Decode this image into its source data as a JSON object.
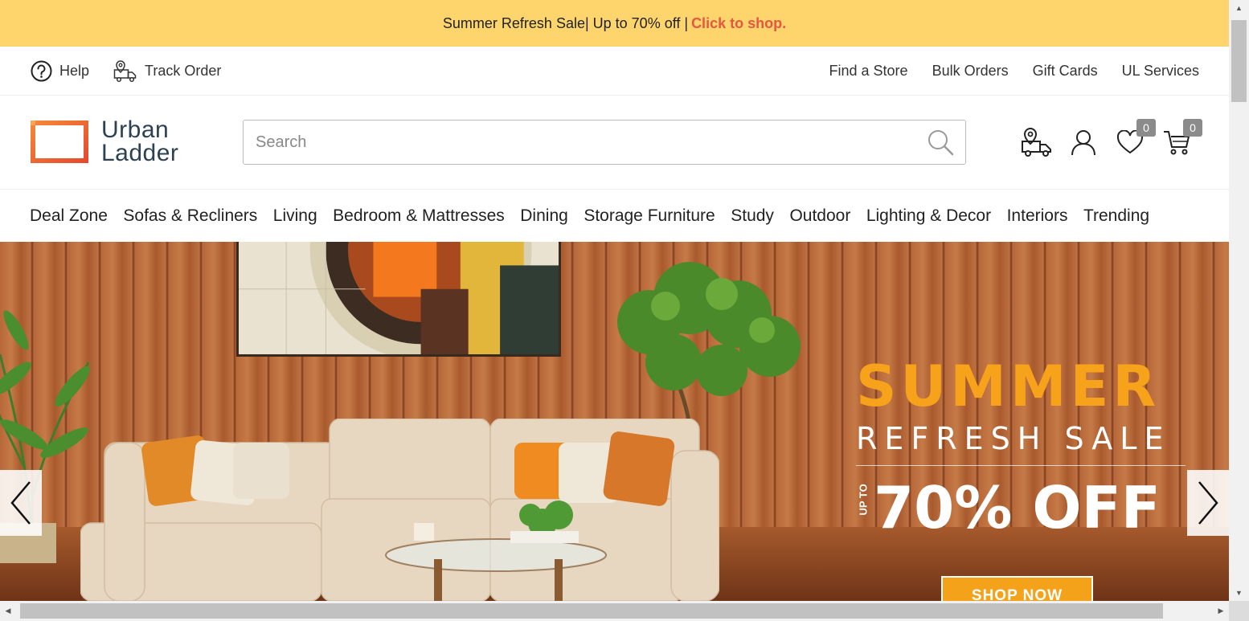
{
  "announcement": {
    "text": "Summer Refresh Sale| Up to 70% off |",
    "link": "Click to shop."
  },
  "utility": {
    "help": "Help",
    "track_order": "Track Order",
    "links": [
      "Find a Store",
      "Bulk Orders",
      "Gift Cards",
      "UL Services"
    ]
  },
  "logo": {
    "line1": "Urban",
    "line2": "Ladder"
  },
  "search": {
    "placeholder": "Search",
    "value": ""
  },
  "header_icons": {
    "wishlist_count": "0",
    "cart_count": "0"
  },
  "nav": [
    "Deal Zone",
    "Sofas & Recliners",
    "Living",
    "Bedroom & Mattresses",
    "Dining",
    "Storage Furniture",
    "Study",
    "Outdoor",
    "Lighting & Decor",
    "Interiors",
    "Trending"
  ],
  "hero": {
    "headline": "SUMMER",
    "subhead": "REFRESH SALE",
    "upto": "UP TO",
    "discount": "70% OFF",
    "cta": "SHOP NOW"
  },
  "colors": {
    "announcement_bg": "#fed56d",
    "link": "#e5573f",
    "cta": "#f5a21b",
    "brand_text": "#2c4152",
    "logo_orange": "#ef6a2b"
  }
}
